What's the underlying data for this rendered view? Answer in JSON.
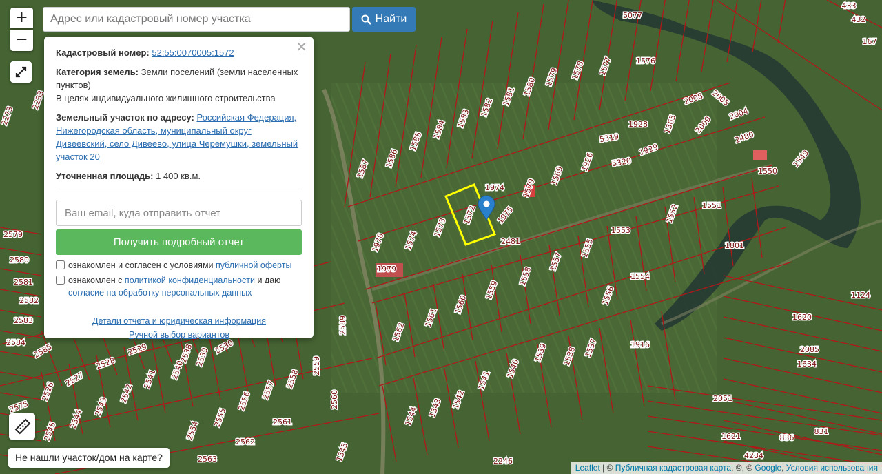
{
  "search": {
    "placeholder": "Адрес или кадастровый номер участка",
    "button_label": "Найти"
  },
  "zoom": {
    "in": "+",
    "out": "−"
  },
  "icons": {
    "search": "search-icon",
    "fullscreen": "fullscreen-icon",
    "ruler": "ruler-icon",
    "marker": "map-marker-icon",
    "close": "close-icon"
  },
  "popup": {
    "cadastral_label": "Кадастровый номер:",
    "cadastral_value": "52:55:0070005:1572",
    "category_label": "Категория земель:",
    "category_value": "Земли поселений (земли населенных пунктов)",
    "category_use": "В целях индивидуального жилищного строительства",
    "address_label": "Земельный участок по адресу:",
    "address_value": "Российская Федерация, Нижегородская область, муниципальный округ Дивеевский, село Дивеево, улица Черемушки, земельный участок 20",
    "area_label": "Уточненная площадь:",
    "area_value": "1 400 кв.м.",
    "email_placeholder": "Ваш email, куда отправить отчет",
    "get_report_button": "Получить подробный отчет",
    "consent1_prefix": "ознакомлен и согласен с условиями",
    "consent1_link": "публичной оферты",
    "consent2_prefix": "ознакомлен с",
    "consent2_link": "политикой конфиденциальности",
    "consent2_mid": "и даю",
    "consent2_link2": "согласие на обработку персональных данных",
    "details_link": "Детали отчета и юридическая информация",
    "manual_link": "Ручной выбор вариантов"
  },
  "not_found_button": "Не нашли участок/дом на карте?",
  "attribution": {
    "leaflet": "Leaflet",
    "sep": " | © ",
    "map": "Публичная кадастровая карта",
    "rest": ", ©, © ",
    "google": "Google",
    "terms": "Условия использования"
  },
  "parcels": [
    "5077",
    "433",
    "432",
    "167",
    "1576",
    "1577",
    "1578",
    "1579",
    "1580",
    "1581",
    "1582",
    "1583",
    "1584",
    "1585",
    "1586",
    "1587",
    "2008",
    "2005",
    "2004",
    "1928",
    "1565",
    "2009",
    "5319",
    "5320",
    "1929",
    "2480",
    "1550",
    "1549",
    "1926",
    "1569",
    "1570",
    "1974",
    "1975",
    "1572",
    "1573",
    "1574",
    "1978",
    "1979",
    "2481",
    "1553",
    "1552",
    "1551",
    "1555",
    "1557",
    "1558",
    "1559",
    "1560",
    "1561",
    "1562",
    "1801",
    "1554",
    "1556",
    "1916",
    "1539",
    "1538",
    "1537",
    "1540",
    "1541",
    "1542",
    "1543",
    "1544",
    "1545",
    "1124",
    "1620",
    "2085",
    "1634",
    "2051",
    "1621",
    "836",
    "831",
    "4234",
    "2246",
    "2589",
    "2560",
    "2559",
    "2558",
    "2557",
    "2556",
    "2555",
    "2554",
    "2561",
    "2562",
    "2563",
    "2579",
    "2580",
    "2581",
    "2582",
    "2583",
    "2584",
    "2585",
    "2526",
    "2527",
    "2528",
    "2529",
    "2530",
    "2538",
    "2539",
    "2540",
    "2541",
    "2542",
    "2543",
    "2544",
    "2545",
    "2575",
    "2233",
    "2273"
  ]
}
